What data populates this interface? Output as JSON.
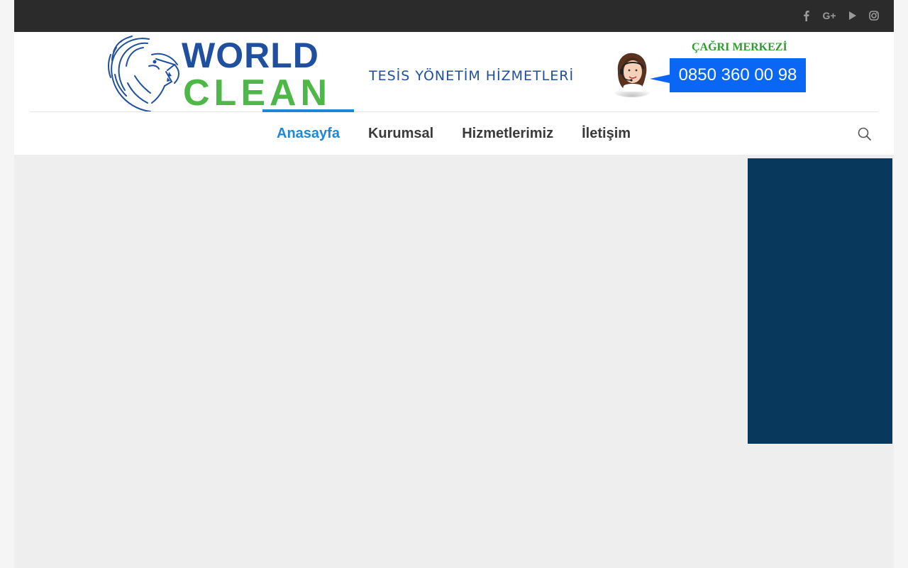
{
  "topbar": {
    "social": [
      {
        "icon": "facebook-icon",
        "glyph": "f"
      },
      {
        "icon": "google-plus-icon",
        "glyph": "G+"
      },
      {
        "icon": "youtube-icon",
        "glyph": "▶"
      },
      {
        "icon": "instagram-icon",
        "glyph": "◎"
      }
    ]
  },
  "header": {
    "logo": {
      "word1": "WORLD",
      "word2": "CLEAN"
    },
    "tagline": "TESİS YÖNETİM HİZMETLERİ",
    "call_center": {
      "title": "ÇAĞRI MERKEZİ",
      "phone": "0850 360 00 98"
    }
  },
  "nav": {
    "items": [
      {
        "label": "Anasayfa",
        "active": true
      },
      {
        "label": "Kurumsal",
        "active": false
      },
      {
        "label": "Hizmetlerimiz",
        "active": false
      },
      {
        "label": "İletişim",
        "active": false
      }
    ]
  },
  "colors": {
    "topbar": "#2b2b2b",
    "accent": "#1e88d8",
    "logo_blue": "#1f4f9e",
    "logo_green": "#4db748",
    "phone_box": "#0a67f5",
    "sidebar_block": "#08385c"
  }
}
